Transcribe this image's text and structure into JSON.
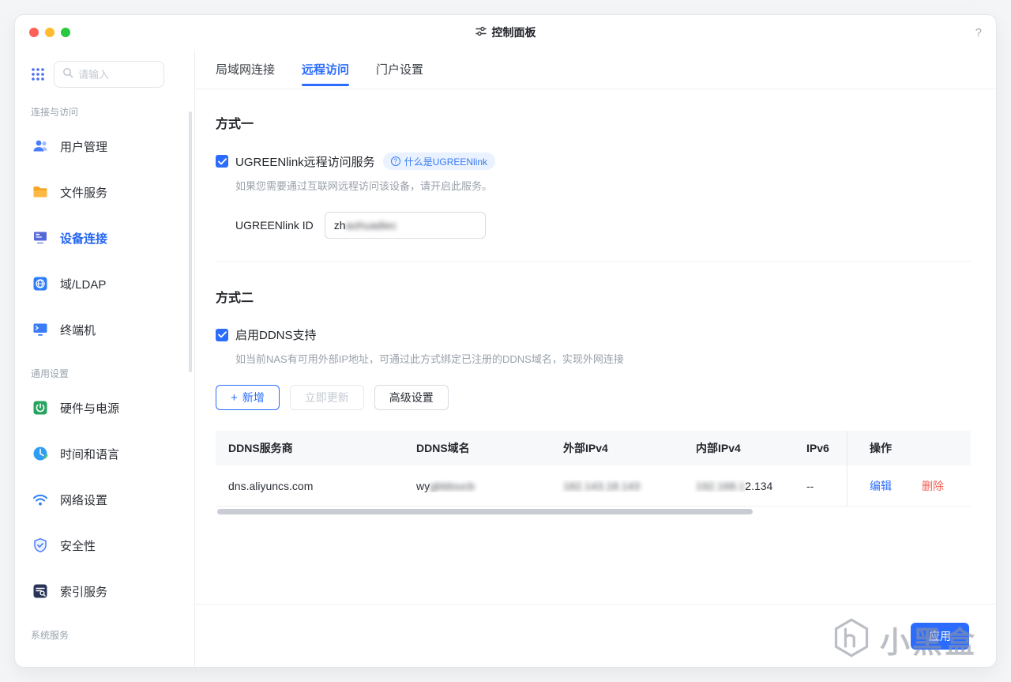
{
  "window": {
    "title": "控制面板",
    "help_label": "?"
  },
  "colors": {
    "accent": "#2b6cff",
    "danger": "#f25c4f",
    "badge_bg": "#e9f2fe"
  },
  "sidebar": {
    "search_placeholder": "请输入",
    "sections": [
      {
        "label": "连接与访问",
        "items": [
          {
            "label": "用户管理"
          },
          {
            "label": "文件服务"
          },
          {
            "label": "设备连接"
          },
          {
            "label": "域/LDAP"
          },
          {
            "label": "终端机"
          }
        ]
      },
      {
        "label": "通用设置",
        "items": [
          {
            "label": "硬件与电源"
          },
          {
            "label": "时间和语言"
          },
          {
            "label": "网络设置"
          },
          {
            "label": "安全性"
          },
          {
            "label": "索引服务"
          }
        ]
      },
      {
        "label": "系统服务",
        "items": []
      }
    ]
  },
  "tabs": [
    {
      "label": "局域网连接"
    },
    {
      "label": "远程访问"
    },
    {
      "label": "门户设置"
    }
  ],
  "method1": {
    "title": "方式一",
    "checkbox_label": "UGREENlink远程访问服务",
    "badge_label": "什么是UGREENlink",
    "description": "如果您需要通过互联网远程访问该设备，请开启此服务。",
    "id_label": "UGREENlink ID",
    "id_value_visible": "zh",
    "id_value_redacted": "aohuadiec"
  },
  "method2": {
    "title": "方式二",
    "checkbox_label": "启用DDNS支持",
    "description": "如当前NAS有可用外部IP地址，可通过此方式绑定已注册的DDNS域名，实现外网连接",
    "add_icon": "+",
    "add_button": "新增",
    "update_button": "立即更新",
    "advanced_button": "高级设置",
    "table": {
      "headers": [
        "DDNS服务商",
        "DDNS域名",
        "外部IPv4",
        "内部IPv4",
        "IPv6",
        "操作"
      ],
      "row": {
        "provider": "dns.aliyuncs.com",
        "domain_visible": "wy",
        "domain_redacted": "gbldoucb",
        "external_ipv4_redacted": "182.143.18.143",
        "internal_ipv4_redacted": "192.168.1",
        "internal_ipv4_visible": "2.134",
        "ipv6": "--",
        "edit_label": "编辑",
        "delete_label": "删除"
      }
    }
  },
  "footer": {
    "apply_label": "应用"
  },
  "watermark": {
    "text": "小黑盒"
  }
}
